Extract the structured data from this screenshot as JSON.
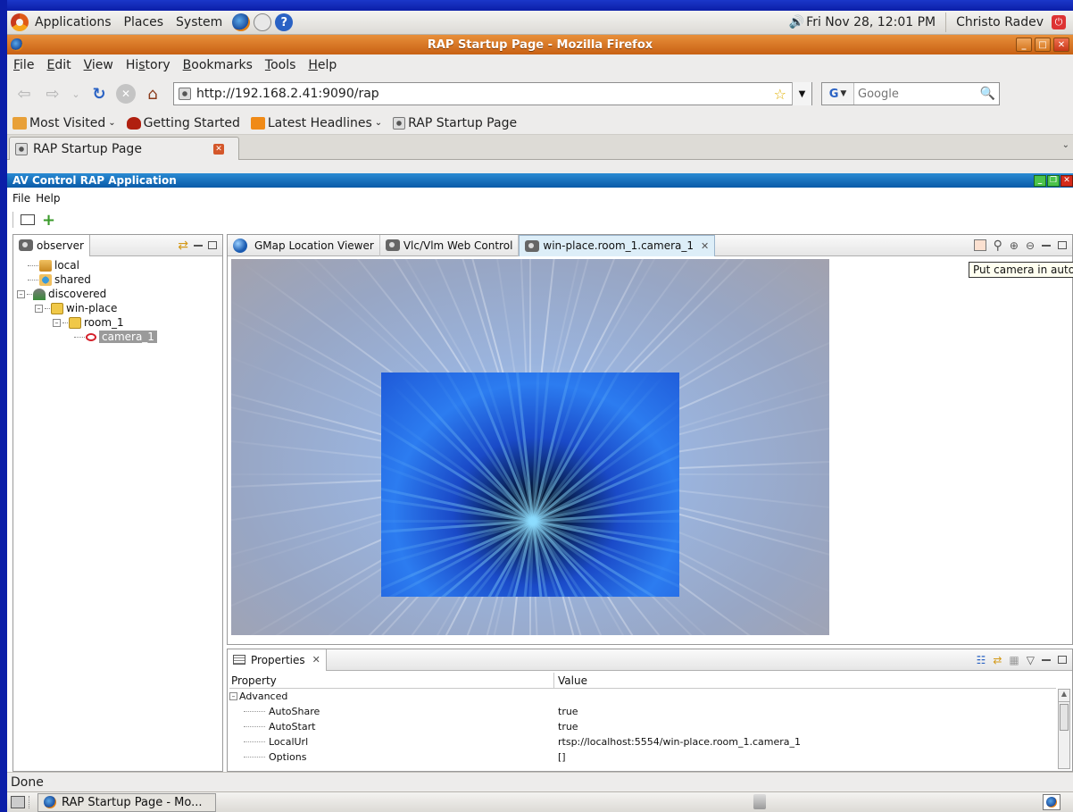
{
  "gnome_panel": {
    "menus": [
      "Applications",
      "Places",
      "System"
    ],
    "clock": "Fri Nov 28, 12:01 PM",
    "user": "Christo Radev"
  },
  "firefox": {
    "window_title": "RAP Startup Page - Mozilla Firefox",
    "menus": [
      {
        "label": "File",
        "u": "F",
        "rest": "ile"
      },
      {
        "label": "Edit",
        "u": "E",
        "rest": "dit"
      },
      {
        "label": "View",
        "u": "V",
        "rest": "iew"
      },
      {
        "label": "History",
        "pre": "Hi",
        "u": "s",
        "rest": "tory"
      },
      {
        "label": "Bookmarks",
        "u": "B",
        "rest": "ookmarks"
      },
      {
        "label": "Tools",
        "u": "T",
        "rest": "ools"
      },
      {
        "label": "Help",
        "u": "H",
        "rest": "elp"
      }
    ],
    "url": "http://192.168.2.41:9090/rap",
    "search_placeholder": "Google",
    "search_engine": "G",
    "bookmarks": {
      "most_visited": "Most Visited",
      "getting_started": "Getting Started",
      "latest_headlines": "Latest Headlines",
      "rap_startup": "RAP Startup Page"
    },
    "tab_label": "RAP Startup Page",
    "status": "Done"
  },
  "rap": {
    "title": "AV Control RAP Application",
    "menus": [
      "File",
      "Help"
    ],
    "observer": {
      "tab": "observer",
      "tree": {
        "local": "local",
        "shared": "shared",
        "discovered": "discovered",
        "win_place": "win-place",
        "room": "room_1",
        "camera": "camera_1"
      }
    },
    "editor": {
      "tabs": [
        "GMap Location Viewer",
        "Vlc/Vlm Web Control",
        "win-place.room_1.camera_1"
      ],
      "tooltip": "Put camera in auto"
    },
    "properties": {
      "tab": "Properties",
      "col_property": "Property",
      "col_value": "Value",
      "group": "Advanced",
      "rows": [
        {
          "name": "AutoShare",
          "value": "true"
        },
        {
          "name": "AutoStart",
          "value": "true"
        },
        {
          "name": "LocalUrl",
          "value": "rtsp://localhost:5554/win-place.room_1.camera_1"
        },
        {
          "name": "Options",
          "value": "[]"
        }
      ]
    }
  },
  "taskbar": {
    "task": "RAP Startup Page - Mo..."
  }
}
